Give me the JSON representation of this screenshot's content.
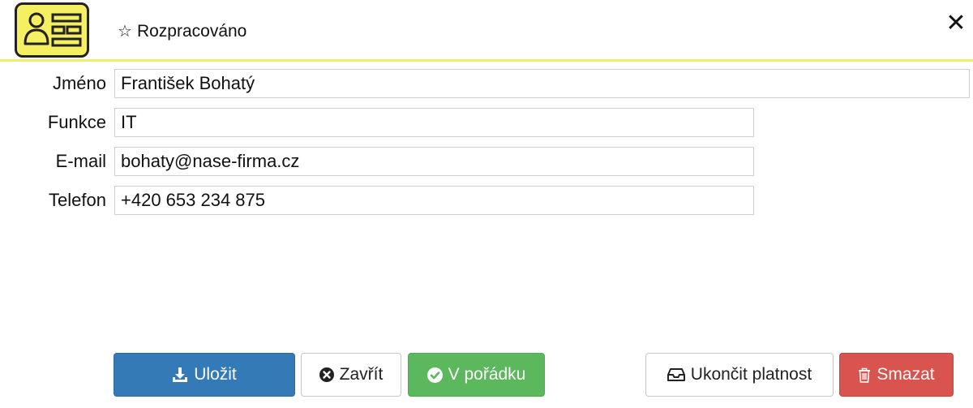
{
  "header": {
    "status_label": "Rozpracováno",
    "close_symbol": "✕"
  },
  "form": {
    "fields": [
      {
        "label": "Jméno",
        "value": "František Bohatý"
      },
      {
        "label": "Funkce",
        "value": "IT"
      },
      {
        "label": "E-mail",
        "value": "bohaty@nase-firma.cz"
      },
      {
        "label": "Telefon",
        "value": "+420 653 234 875"
      }
    ]
  },
  "buttons": {
    "save": "Uložit",
    "close": "Zavřít",
    "ok": "V pořádku",
    "terminate": "Ukončit platnost",
    "delete": "Smazat"
  },
  "icons": {
    "app": "contact-card-icon",
    "status": "star-outline-icon",
    "save": "download-icon",
    "close": "times-circle-icon",
    "ok": "check-circle-icon",
    "terminate": "inbox-icon",
    "delete": "trash-icon"
  },
  "colors": {
    "header_accent": "#f2ec66",
    "app_icon_bg": "#f5ef62",
    "primary": "#337ab7",
    "success": "#5cb85c",
    "danger": "#d9534f"
  }
}
